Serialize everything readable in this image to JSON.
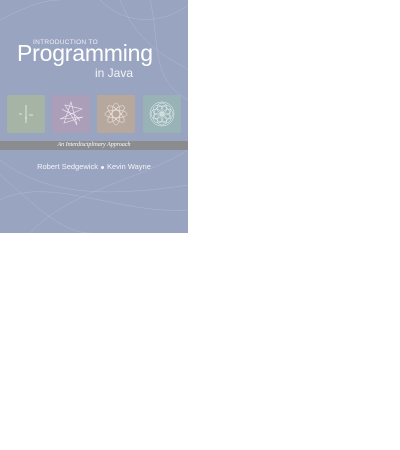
{
  "cover": {
    "title_intro": "INTRODUCTION TO",
    "title_main": "Programming",
    "title_sub": "in Java",
    "subtitle_band": "An Interdisciplinary Approach",
    "authors": [
      "Robert Sedgewick",
      "Kevin Wayne"
    ],
    "tiles": [
      {
        "icon": "plot-tile-icon",
        "color": "#a6b4a6"
      },
      {
        "icon": "star-curve-tile-icon",
        "color": "#aa9eb8"
      },
      {
        "icon": "spirograph-tile-icon",
        "color": "#b6a89c"
      },
      {
        "icon": "rosette-tile-icon",
        "color": "#98b2b6"
      }
    ],
    "colors": {
      "background": "#99a4c0",
      "band": "#8a8c8e",
      "text": "#ffffff"
    }
  }
}
